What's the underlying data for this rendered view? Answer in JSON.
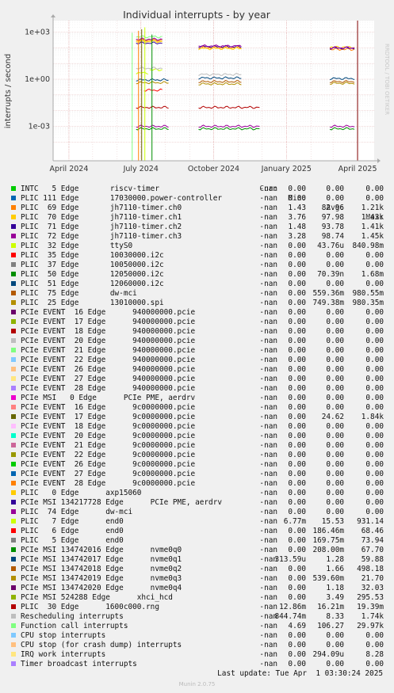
{
  "chart_data": {
    "type": "line",
    "title": "Individual interrupts - by year",
    "ylabel": "interrupts / second",
    "y_scale": "log",
    "y_ticks": [
      "1e+03",
      "1e+00",
      "1e-03"
    ],
    "x_ticks": [
      "April 2024",
      "July 2024",
      "October 2024",
      "January 2025",
      "April 2025"
    ],
    "side_label": "RRDTOOL / TOBI OETIKER",
    "grid": true,
    "columns": {
      "cur": "Cur:",
      "min": "Min:",
      "avg": "Avg:",
      "max": "Max:"
    },
    "series": [
      {
        "name": "INTC   5 Edge       riscv-timer",
        "color": "#00cc00",
        "cur": "-nan",
        "min": "0.00",
        "avg": "0.00",
        "max": "0.00"
      },
      {
        "name": "PLIC 111 Edge       17030000.power-controller",
        "color": "#0066b3",
        "cur": "-nan",
        "min": "0.00",
        "avg": "0.00",
        "max": "0.00"
      },
      {
        "name": "PLIC  69 Edge       jh7110-timer.ch0",
        "color": "#ff8000",
        "cur": "-nan",
        "min": "1.43",
        "avg": "82.96",
        "max": "1.21k"
      },
      {
        "name": "PLIC  70 Edge       jh7110-timer.ch1",
        "color": "#ffcc00",
        "cur": "-nan",
        "min": "3.76",
        "avg": "97.98",
        "max": "1.43k"
      },
      {
        "name": "PLIC  71 Edge       jh7110-timer.ch2",
        "color": "#330099",
        "cur": "-nan",
        "min": "1.48",
        "avg": "93.78",
        "max": "1.41k"
      },
      {
        "name": "PLIC  72 Edge       jh7110-timer.ch3",
        "color": "#990099",
        "cur": "-nan",
        "min": "3.28",
        "avg": "98.74",
        "max": "1.45k"
      },
      {
        "name": "PLIC  32 Edge       ttyS0",
        "color": "#ccff00",
        "cur": "-nan",
        "min": "0.00",
        "avg": "43.76u",
        "max": "840.98m"
      },
      {
        "name": "PLIC  35 Edge       10030000.i2c",
        "color": "#ff0000",
        "cur": "-nan",
        "min": "0.00",
        "avg": "0.00",
        "max": "0.00"
      },
      {
        "name": "PLIC  37 Edge       10050000.i2c",
        "color": "#808080",
        "cur": "-nan",
        "min": "0.00",
        "avg": "0.00",
        "max": "0.00"
      },
      {
        "name": "PLIC  50 Edge       12050000.i2c",
        "color": "#008f00",
        "cur": "-nan",
        "min": "0.00",
        "avg": "70.39n",
        "max": "1.68m"
      },
      {
        "name": "PLIC  51 Edge       12060000.i2c",
        "color": "#00487d",
        "cur": "-nan",
        "min": "0.00",
        "avg": "0.00",
        "max": "0.00"
      },
      {
        "name": "PLIC  75 Edge       dw-mci",
        "color": "#b35a00",
        "cur": "-nan",
        "min": "0.00",
        "avg": "559.36m",
        "max": "980.55m"
      },
      {
        "name": "PLIC  25 Edge       13010000.spi",
        "color": "#b38f00",
        "cur": "-nan",
        "min": "0.00",
        "avg": "749.38m",
        "max": "980.35m"
      },
      {
        "name": "PCIe EVENT  16 Edge      940000000.pcie",
        "color": "#6b006b",
        "cur": "-nan",
        "min": "0.00",
        "avg": "0.00",
        "max": "0.00"
      },
      {
        "name": "PCIe EVENT  17 Edge      940000000.pcie",
        "color": "#8fb300",
        "cur": "-nan",
        "min": "0.00",
        "avg": "0.00",
        "max": "0.00"
      },
      {
        "name": "PCIe EVENT  18 Edge      940000000.pcie",
        "color": "#b30000",
        "cur": "-nan",
        "min": "0.00",
        "avg": "0.00",
        "max": "0.00"
      },
      {
        "name": "PCIe EVENT  20 Edge      940000000.pcie",
        "color": "#bebebe",
        "cur": "-nan",
        "min": "0.00",
        "avg": "0.00",
        "max": "0.00"
      },
      {
        "name": "PCIe EVENT  21 Edge      940000000.pcie",
        "color": "#80ff80",
        "cur": "-nan",
        "min": "0.00",
        "avg": "0.00",
        "max": "0.00"
      },
      {
        "name": "PCIe EVENT  22 Edge      940000000.pcie",
        "color": "#80c9ff",
        "cur": "-nan",
        "min": "0.00",
        "avg": "0.00",
        "max": "0.00"
      },
      {
        "name": "PCIe EVENT  26 Edge      940000000.pcie",
        "color": "#ffc080",
        "cur": "-nan",
        "min": "0.00",
        "avg": "0.00",
        "max": "0.00"
      },
      {
        "name": "PCIe EVENT  27 Edge      940000000.pcie",
        "color": "#ffe680",
        "cur": "-nan",
        "min": "0.00",
        "avg": "0.00",
        "max": "0.00"
      },
      {
        "name": "PCIe EVENT  28 Edge      940000000.pcie",
        "color": "#aa80ff",
        "cur": "-nan",
        "min": "0.00",
        "avg": "0.00",
        "max": "0.00"
      },
      {
        "name": "PCIe MSI   0 Edge      PCIe PME, aerdrv",
        "color": "#ee00cc",
        "cur": "-nan",
        "min": "0.00",
        "avg": "0.00",
        "max": "0.00"
      },
      {
        "name": "PCIe EVENT  16 Edge      9c0000000.pcie",
        "color": "#ff8080",
        "cur": "-nan",
        "min": "0.00",
        "avg": "0.00",
        "max": "0.00"
      },
      {
        "name": "PCIe EVENT  17 Edge      9c0000000.pcie",
        "color": "#666600",
        "cur": "-nan",
        "min": "0.00",
        "avg": "24.62",
        "max": "1.84k"
      },
      {
        "name": "PCIe EVENT  18 Edge      9c0000000.pcie",
        "color": "#ffbfff",
        "cur": "-nan",
        "min": "0.00",
        "avg": "0.00",
        "max": "0.00"
      },
      {
        "name": "PCIe EVENT  20 Edge      9c0000000.pcie",
        "color": "#00ffcc",
        "cur": "-nan",
        "min": "0.00",
        "avg": "0.00",
        "max": "0.00"
      },
      {
        "name": "PCIe EVENT  21 Edge      9c0000000.pcie",
        "color": "#cc6699",
        "cur": "-nan",
        "min": "0.00",
        "avg": "0.00",
        "max": "0.00"
      },
      {
        "name": "PCIe EVENT  22 Edge      9c0000000.pcie",
        "color": "#999900",
        "cur": "-nan",
        "min": "0.00",
        "avg": "0.00",
        "max": "0.00"
      },
      {
        "name": "PCIe EVENT  26 Edge      9c0000000.pcie",
        "color": "#00cc00",
        "cur": "-nan",
        "min": "0.00",
        "avg": "0.00",
        "max": "0.00"
      },
      {
        "name": "PCIe EVENT  27 Edge      9c0000000.pcie",
        "color": "#0066b3",
        "cur": "-nan",
        "min": "0.00",
        "avg": "0.00",
        "max": "0.00"
      },
      {
        "name": "PCIe EVENT  28 Edge      9c0000000.pcie",
        "color": "#ff8000",
        "cur": "-nan",
        "min": "0.00",
        "avg": "0.00",
        "max": "0.00"
      },
      {
        "name": "PLIC   0 Edge      axp15060",
        "color": "#ffcc00",
        "cur": "-nan",
        "min": "0.00",
        "avg": "0.00",
        "max": "0.00"
      },
      {
        "name": "PCIe MSI 134217728 Edge      PCIe PME, aerdrv",
        "color": "#330099",
        "cur": "-nan",
        "min": "0.00",
        "avg": "0.00",
        "max": "0.00"
      },
      {
        "name": "PLIC  74 Edge      dw-mci",
        "color": "#990099",
        "cur": "-nan",
        "min": "0.00",
        "avg": "0.00",
        "max": "0.00"
      },
      {
        "name": "PLIC   7 Edge      end0",
        "color": "#ccff00",
        "cur": "-nan",
        "min": "6.77m",
        "avg": "15.53",
        "max": "931.14"
      },
      {
        "name": "PLIC   6 Edge      end0",
        "color": "#ff0000",
        "cur": "-nan",
        "min": "0.00",
        "avg": "186.46m",
        "max": "68.46"
      },
      {
        "name": "PLIC   5 Edge      end0",
        "color": "#808080",
        "cur": "-nan",
        "min": "0.00",
        "avg": "169.75m",
        "max": "73.94"
      },
      {
        "name": "PCIe MSI 134742016 Edge      nvme0q0",
        "color": "#008f00",
        "cur": "-nan",
        "min": "0.00",
        "avg": "208.00m",
        "max": "67.70"
      },
      {
        "name": "PCIe MSI 134742017 Edge      nvme0q1",
        "color": "#00487d",
        "cur": "-nan",
        "min": "313.59u",
        "avg": "1.28",
        "max": "59.88"
      },
      {
        "name": "PCIe MSI 134742018 Edge      nvme0q2",
        "color": "#b35a00",
        "cur": "-nan",
        "min": "0.00",
        "avg": "1.66",
        "max": "498.18"
      },
      {
        "name": "PCIe MSI 134742019 Edge      nvme0q3",
        "color": "#b38f00",
        "cur": "-nan",
        "min": "0.00",
        "avg": "539.60m",
        "max": "21.70"
      },
      {
        "name": "PCIe MSI 134742020 Edge      nvme0q4",
        "color": "#6b006b",
        "cur": "-nan",
        "min": "0.00",
        "avg": "1.18",
        "max": "32.03"
      },
      {
        "name": "PCIe MSI 524288 Edge      xhci_hcd",
        "color": "#8fb300",
        "cur": "-nan",
        "min": "0.00",
        "avg": "3.49",
        "max": "295.53"
      },
      {
        "name": "PLIC  30 Edge      1600c000.rng",
        "color": "#b30000",
        "cur": "-nan",
        "min": "12.86m",
        "avg": "16.21m",
        "max": "19.39m"
      },
      {
        "name": "Rescheduling interrupts",
        "color": "#bebebe",
        "cur": "-nan",
        "min": "844.74m",
        "avg": "8.33",
        "max": "1.74k"
      },
      {
        "name": "Function call interrupts",
        "color": "#80ff80",
        "cur": "-nan",
        "min": "4.69",
        "avg": "106.27",
        "max": "29.97k"
      },
      {
        "name": "CPU stop interrupts",
        "color": "#80c9ff",
        "cur": "-nan",
        "min": "0.00",
        "avg": "0.00",
        "max": "0.00"
      },
      {
        "name": "CPU stop (for crash dump) interrupts",
        "color": "#ffc080",
        "cur": "-nan",
        "min": "0.00",
        "avg": "0.00",
        "max": "0.00"
      },
      {
        "name": "IRQ work interrupts",
        "color": "#ffe680",
        "cur": "-nan",
        "min": "0.00",
        "avg": "294.09u",
        "max": "8.28"
      },
      {
        "name": "Timer broadcast interrupts",
        "color": "#aa80ff",
        "cur": "-nan",
        "min": "0.00",
        "avg": "0.00",
        "max": "0.00"
      }
    ],
    "plot_segments": [
      {
        "color": "#ff8000",
        "periods": [
          [
            "2024-06-25",
            "2024-07-28",
            300
          ],
          [
            "2024-09-12",
            "2024-11-05",
            100
          ],
          [
            "2025-02-25",
            "2025-03-28",
            80
          ]
        ]
      },
      {
        "color": "#ffcc00",
        "periods": [
          [
            "2024-06-25",
            "2024-07-28",
            250
          ],
          [
            "2024-09-12",
            "2024-11-05",
            90
          ],
          [
            "2025-02-25",
            "2025-03-28",
            110
          ]
        ]
      },
      {
        "color": "#330099",
        "periods": [
          [
            "2024-06-25",
            "2024-07-28",
            200
          ],
          [
            "2024-09-12",
            "2024-11-05",
            120
          ],
          [
            "2025-02-25",
            "2025-03-28",
            95
          ]
        ]
      },
      {
        "color": "#990099",
        "periods": [
          [
            "2024-06-25",
            "2024-07-28",
            350
          ],
          [
            "2024-09-12",
            "2024-11-05",
            130
          ],
          [
            "2025-02-25",
            "2025-03-28",
            100
          ]
        ]
      },
      {
        "color": "#80ff80",
        "periods": [
          [
            "2024-06-25",
            "2024-07-28",
            500
          ]
        ]
      },
      {
        "color": "#00487d",
        "periods": [
          [
            "2024-06-25",
            "2024-08-05",
            0.9
          ],
          [
            "2024-09-12",
            "2024-11-05",
            1.2
          ],
          [
            "2025-02-25",
            "2025-03-28",
            1.1
          ]
        ]
      },
      {
        "color": "#b38f00",
        "periods": [
          [
            "2024-06-25",
            "2024-08-05",
            0.6
          ],
          [
            "2024-09-12",
            "2024-11-05",
            0.5
          ],
          [
            "2025-02-25",
            "2025-03-28",
            0.55
          ]
        ]
      },
      {
        "color": "#b35a00",
        "periods": [
          [
            "2024-09-12",
            "2024-11-05",
            0.7
          ],
          [
            "2025-02-25",
            "2025-03-28",
            0.7
          ]
        ]
      },
      {
        "color": "#ccff00",
        "periods": [
          [
            "2024-06-25",
            "2024-07-10",
            2.5
          ],
          [
            "2024-07-12",
            "2024-07-28",
            4.0
          ]
        ]
      },
      {
        "color": "#bebebe",
        "periods": [
          [
            "2024-06-25",
            "2024-07-28",
            5.0
          ],
          [
            "2024-09-12",
            "2024-11-05",
            2.0
          ]
        ]
      },
      {
        "color": "#990099",
        "periods": [
          [
            "2024-06-25",
            "2024-08-05",
            0.001
          ],
          [
            "2024-09-12",
            "2024-11-28",
            0.001
          ],
          [
            "2025-02-25",
            "2025-03-28",
            0.001
          ]
        ]
      },
      {
        "color": "#008f00",
        "periods": [
          [
            "2024-06-25",
            "2024-08-05",
            0.0007
          ],
          [
            "2024-09-12",
            "2024-11-28",
            0.0007
          ],
          [
            "2025-02-25",
            "2025-03-28",
            0.0007
          ]
        ]
      },
      {
        "color": "#b30000",
        "periods": [
          [
            "2024-06-25",
            "2024-08-05",
            0.016
          ],
          [
            "2024-09-12",
            "2024-11-28",
            0.016
          ]
        ]
      },
      {
        "color": "#ff0000",
        "periods": [
          [
            "2024-07-05",
            "2024-07-28",
            0.2
          ]
        ]
      }
    ]
  },
  "footer": {
    "last_update": "Last update: Tue Apr  1 03:30:24 2025",
    "generator": "Munin 2.0.75"
  }
}
